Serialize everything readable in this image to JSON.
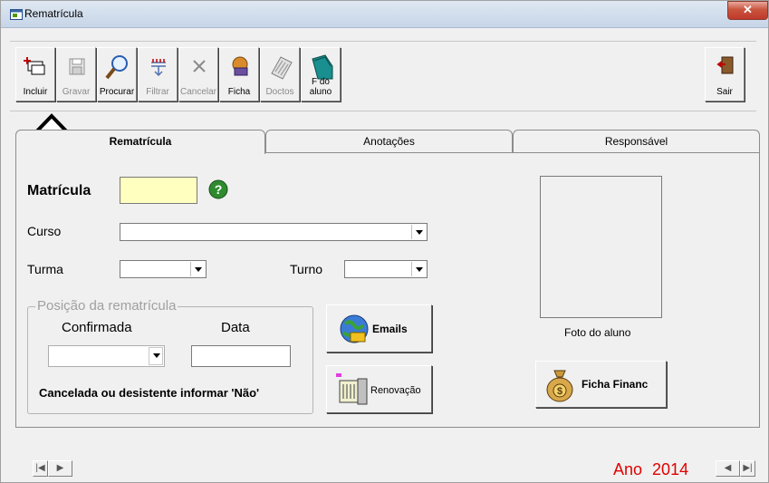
{
  "window": {
    "title": "Rematrícula",
    "close_label": "✕"
  },
  "toolbar": {
    "buttons": [
      {
        "label": "Incluir",
        "icon": "add-record-icon",
        "enabled": true
      },
      {
        "label": "Gravar",
        "icon": "save-disk-icon",
        "enabled": false
      },
      {
        "label": "Procurar",
        "icon": "magnifier-icon",
        "enabled": true
      },
      {
        "label": "Filtrar",
        "icon": "filter-icon",
        "enabled": false
      },
      {
        "label": "Cancelar",
        "icon": "cancel-x-icon",
        "enabled": false
      },
      {
        "label": "Ficha",
        "icon": "ficha-icon",
        "enabled": true
      },
      {
        "label": "Doctos",
        "icon": "documents-icon",
        "enabled": false
      },
      {
        "label": "F do aluno",
        "icon": "student-folder-icon",
        "enabled": true
      },
      {
        "label": "Sair",
        "icon": "exit-door-icon",
        "enabled": true
      }
    ]
  },
  "tabs": [
    {
      "label": "Rematrícula",
      "active": true
    },
    {
      "label": "Anotações",
      "active": false
    },
    {
      "label": "Responsável",
      "active": false
    }
  ],
  "form": {
    "matricula_label": "Matrícula",
    "matricula_value": "",
    "matricula_bg": "#ffffc0",
    "curso_label": "Curso",
    "curso_value": "",
    "turma_label": "Turma",
    "turma_value": "",
    "turno_label": "Turno",
    "turno_value": ""
  },
  "posicao": {
    "title": "Posição da rematrícula",
    "confirmada_label": "Confirmada",
    "confirmada_value": "",
    "data_label": "Data",
    "data_value": "",
    "note": "Cancelada ou desistente informar 'Não'"
  },
  "actions": {
    "emails_label": "Emails",
    "renovacao_label": "Renovação",
    "ficha_financ_label": "Ficha Financ"
  },
  "photo": {
    "caption": "Foto do aluno"
  },
  "footer": {
    "ano_label": "Ano",
    "ano_value": "2014",
    "accent": "#e00000"
  }
}
